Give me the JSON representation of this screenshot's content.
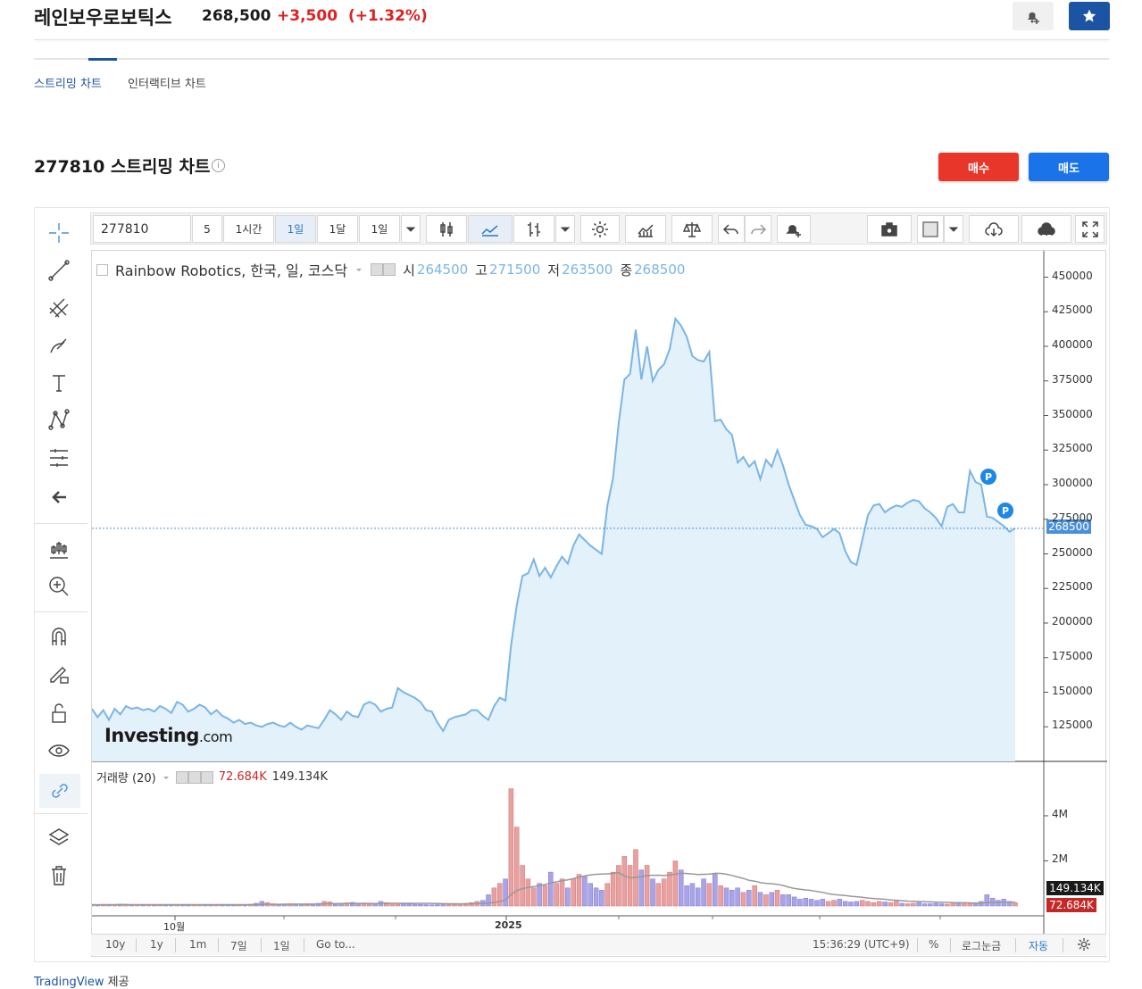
{
  "header": {
    "stock_name": "레인보우로보틱스",
    "price": "268,500",
    "change": "+3,500",
    "change_pct": "(+1.32%)"
  },
  "tabs": [
    {
      "label": "스트리밍 차트",
      "active": true
    },
    {
      "label": "인터랙티브 차트",
      "active": false
    }
  ],
  "section": {
    "title": "277810 스트리밍 차트",
    "info_icon": "i",
    "buy_label": "매수",
    "sell_label": "매도"
  },
  "toolbar": {
    "symbol": "277810",
    "intervals": [
      "5",
      "1시간",
      "1일",
      "1달",
      "1일"
    ],
    "active_interval": "1일"
  },
  "legend": {
    "title": "Rainbow Robotics, 한국, 일, 코스닥",
    "open_label": "시",
    "open": "264500",
    "high_label": "고",
    "high": "271500",
    "low_label": "저",
    "low": "263500",
    "close_label": "종",
    "close": "268500"
  },
  "volume_legend": {
    "title": "거래량 (20)",
    "v1": "72.684K",
    "v2": "149.134K"
  },
  "logo": {
    "main": "Investing",
    "suffix": ".com"
  },
  "price_badge": "268500",
  "volume_badges": {
    "ma": "149.134K",
    "vol": "72.684K"
  },
  "y_ticks": [
    "450000",
    "425000",
    "400000",
    "375000",
    "350000",
    "325000",
    "300000",
    "275000",
    "250000",
    "225000",
    "200000",
    "175000",
    "150000",
    "125000"
  ],
  "vol_ticks": [
    "4M",
    "2M"
  ],
  "x_ticks": [
    "10월",
    "2025"
  ],
  "bottom_bar": {
    "ranges": [
      "10y",
      "1y",
      "1m",
      "7일",
      "1일"
    ],
    "goto": "Go to...",
    "time": "15:36:29 (UTC+9)",
    "pct": "%",
    "log": "로그눈금",
    "auto": "자동"
  },
  "markers": [
    "P",
    "P"
  ],
  "footer": {
    "link": "TradingView",
    "suffix": " 제공"
  },
  "colors": {
    "accent": "#1b54a3",
    "up": "#e02020",
    "line": "#7ab5e6",
    "area": "#e3f1fa",
    "buy": "#e8362b",
    "sell": "#1a73e8"
  },
  "chart_data": {
    "type": "area",
    "price_axis": {
      "min": 100000,
      "max": 460000
    },
    "close": [
      138000,
      132000,
      137000,
      130000,
      138000,
      134000,
      140000,
      138000,
      139000,
      137000,
      138000,
      136000,
      140000,
      138000,
      135000,
      143000,
      141000,
      136000,
      138000,
      141000,
      139000,
      134000,
      137000,
      133000,
      131000,
      128000,
      130000,
      127000,
      128000,
      126000,
      125000,
      127000,
      128000,
      126000,
      125000,
      128000,
      125000,
      123000,
      126000,
      125000,
      124000,
      130000,
      137000,
      134000,
      130000,
      136000,
      133000,
      132000,
      141000,
      143000,
      141000,
      136000,
      138000,
      139000,
      153000,
      150000,
      148000,
      146000,
      143000,
      137000,
      136000,
      128000,
      122000,
      130000,
      132000,
      133000,
      134000,
      137000,
      137000,
      133000,
      130000,
      140000,
      146000,
      144000,
      184000,
      213000,
      234000,
      236000,
      246000,
      234000,
      240000,
      233000,
      241000,
      248000,
      243000,
      256000,
      264000,
      260000,
      256000,
      253000,
      250000,
      285000,
      305000,
      345000,
      376000,
      380000,
      412000,
      376000,
      400000,
      375000,
      383000,
      387000,
      398000,
      420000,
      415000,
      407000,
      393000,
      390000,
      389000,
      396000,
      346000,
      347000,
      340000,
      336000,
      316000,
      320000,
      313000,
      317000,
      304000,
      318000,
      313000,
      325000,
      314000,
      300000,
      289000,
      278000,
      271000,
      270000,
      268000,
      262000,
      265000,
      268000,
      265000,
      252000,
      244000,
      242000,
      260000,
      278000,
      285000,
      286000,
      280000,
      283000,
      285000,
      284000,
      287000,
      289000,
      288000,
      283000,
      280000,
      276000,
      270000,
      284000,
      286000,
      280000,
      280000,
      310000,
      302000,
      300000,
      277000,
      276000,
      273000,
      270000,
      266000,
      268500
    ],
    "volume_M": [
      0.06,
      0.05,
      0.07,
      0.05,
      0.06,
      0.08,
      0.06,
      0.05,
      0.07,
      0.06,
      0.05,
      0.06,
      0.07,
      0.05,
      0.06,
      0.05,
      0.06,
      0.07,
      0.05,
      0.06,
      0.05,
      0.06,
      0.05,
      0.07,
      0.05,
      0.06,
      0.05,
      0.06,
      0.08,
      0.12,
      0.2,
      0.15,
      0.1,
      0.08,
      0.09,
      0.1,
      0.08,
      0.07,
      0.06,
      0.1,
      0.12,
      0.2,
      0.18,
      0.08,
      0.12,
      0.14,
      0.16,
      0.1,
      0.12,
      0.08,
      0.1,
      0.2,
      0.15,
      0.12,
      0.08,
      0.1,
      0.09,
      0.08,
      0.07,
      0.06,
      0.05,
      0.06,
      0.06,
      0.07,
      0.08,
      0.1,
      0.12,
      0.15,
      0.2,
      0.25,
      0.5,
      0.8,
      1.0,
      1.2,
      5.2,
      3.5,
      1.8,
      1.2,
      0.8,
      1.0,
      0.9,
      1.5,
      1.0,
      1.2,
      0.8,
      1.2,
      1.4,
      1.3,
      1.0,
      0.8,
      0.7,
      1.0,
      1.5,
      1.8,
      2.2,
      1.8,
      2.5,
      1.6,
      1.8,
      1.2,
      1.0,
      1.2,
      1.5,
      2.0,
      1.6,
      0.9,
      1.0,
      0.8,
      1.2,
      1.0,
      1.4,
      0.9,
      0.8,
      0.7,
      0.8,
      0.6,
      0.7,
      0.9,
      0.6,
      0.5,
      0.6,
      0.7,
      0.5,
      0.5,
      0.4,
      0.3,
      0.35,
      0.3,
      0.25,
      0.3,
      0.2,
      0.25,
      0.3,
      0.2,
      0.18,
      0.2,
      0.25,
      0.2,
      0.15,
      0.2,
      0.18,
      0.15,
      0.2,
      0.12,
      0.1,
      0.12,
      0.15,
      0.1,
      0.1,
      0.12,
      0.1,
      0.08,
      0.1,
      0.12,
      0.1,
      0.1,
      0.15,
      0.2,
      0.5,
      0.35,
      0.25,
      0.3,
      0.2,
      0.15,
      0.1,
      0.07
    ],
    "volume_axis": {
      "min": 0,
      "max": 5.7
    }
  }
}
